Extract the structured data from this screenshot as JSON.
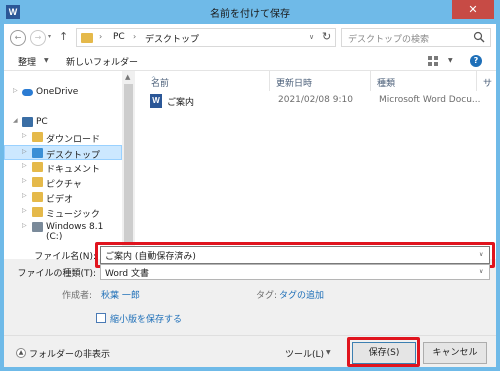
{
  "window": {
    "title": "名前を付けて保存",
    "app_icon": "W",
    "close_glyph": "✕"
  },
  "nav": {
    "back_glyph": "←",
    "forward_glyph": "→",
    "recent_glyph": "▾",
    "up_glyph": "↑"
  },
  "address": {
    "sep1": "›",
    "pc": "PC",
    "sep2": "›",
    "folder": "デスクトップ",
    "dropdown_glyph": "∨",
    "refresh_glyph": "↻"
  },
  "search": {
    "placeholder": "デスクトップの検索"
  },
  "toolbar": {
    "organize": "整理",
    "organize_dd": "▼",
    "new_folder": "新しいフォルダー",
    "view_dd": "▼",
    "help_glyph": "?"
  },
  "sidebar": {
    "items": [
      {
        "label": "OneDrive",
        "expander": "▷"
      },
      {
        "label": "PC",
        "expander": "◢"
      },
      {
        "label": "ダウンロード",
        "expander": "▷"
      },
      {
        "label": "デスクトップ",
        "expander": "▷"
      },
      {
        "label": "ドキュメント",
        "expander": "▷"
      },
      {
        "label": "ピクチャ",
        "expander": "▷"
      },
      {
        "label": "ビデオ",
        "expander": "▷"
      },
      {
        "label": "ミュージック",
        "expander": "▷"
      },
      {
        "label": "Windows 8.1 (C:)",
        "expander": "▷"
      }
    ],
    "scroll_up": "▲",
    "scroll_down": "▼"
  },
  "filelist": {
    "columns": [
      "名前",
      "更新日時",
      "種類",
      "サ"
    ],
    "sort_glyph": "^",
    "rows": [
      {
        "icon": "W",
        "name": "ご案内",
        "modified": "2021/02/08 9:10",
        "type": "Microsoft Word Docu..."
      }
    ]
  },
  "form": {
    "filename_label": "ファイル名(N):",
    "filename_value": "ご案内 (自動保存済み)",
    "filetype_label": "ファイルの種類(T):",
    "filetype_value": "Word 文書",
    "dropdown_glyph": "∨",
    "author_label": "作成者:",
    "author_value": "秋葉 一郎",
    "tags_label": "タグ:",
    "tags_value": "タグの追加",
    "thumbnail_label": "縮小版を保存する"
  },
  "footer": {
    "hide_folders_glyph": "▲",
    "hide_folders": "フォルダーの非表示",
    "tools": "ツール(L)",
    "tools_dd": "▼",
    "save": "保存(S)",
    "cancel": "キャンセル"
  },
  "colors": {
    "title_bar": "#6fbae8",
    "close": "#c74b45",
    "highlight": "#e0141e",
    "link": "#1e6fb8",
    "selection": "#cce8ff"
  }
}
